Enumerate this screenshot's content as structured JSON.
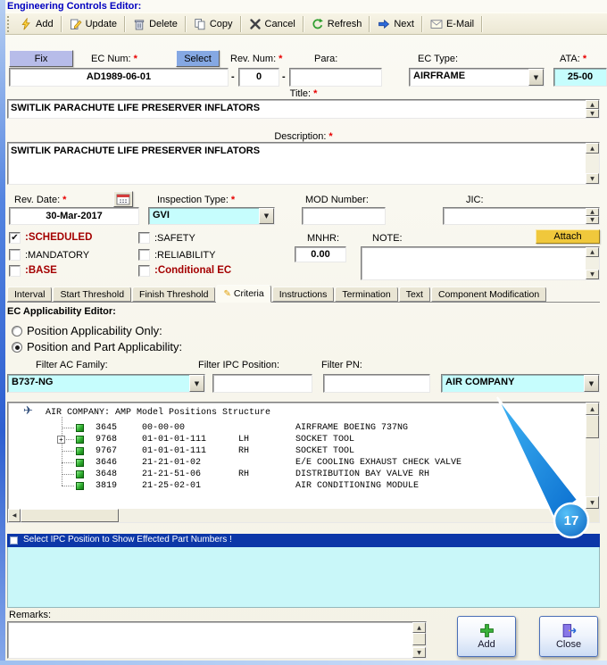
{
  "window": {
    "title": "Engineering Controls Editor:"
  },
  "toolbar": {
    "buttons": [
      "Add",
      "Update",
      "Delete",
      "Copy",
      "Cancel",
      "Refresh",
      "Next",
      "E-Mail"
    ]
  },
  "header": {
    "fix_button": "Fix",
    "ec_num_label": "EC Num:",
    "select_button": "Select",
    "ec_num_value": "AD1989-06-01",
    "dash": "-",
    "rev_num_label": "Rev. Num:",
    "rev_num_value": "0",
    "para_label": "Para:",
    "para_value": "",
    "ec_type_label": "EC Type:",
    "ec_type_value": "AIRFRAME",
    "ata_label": "ATA:",
    "ata_value": "25-00",
    "required_mark": "*"
  },
  "title_section": {
    "label": "Title:",
    "value": "SWITLIK PARACHUTE LIFE PRESERVER INFLATORS"
  },
  "description_section": {
    "label": "Description:",
    "value": "SWITLIK PARACHUTE LIFE PRESERVER INFLATORS"
  },
  "details": {
    "rev_date_label": "Rev. Date:",
    "rev_date_value": "30-Mar-2017",
    "inspection_type_label": "Inspection Type:",
    "inspection_type_value": "GVI",
    "mod_number_label": "MOD Number:",
    "mod_number_value": "",
    "jic_label": "JIC:",
    "jic_value": ""
  },
  "flags": {
    "scheduled_label": ":SCHEDULED",
    "scheduled_checked": true,
    "safety_label": ":SAFETY",
    "safety_checked": false,
    "mandatory_label": ":MANDATORY",
    "mandatory_checked": false,
    "reliability_label": ":RELIABILITY",
    "reliability_checked": false,
    "base_label": ":BASE",
    "base_checked": false,
    "conditional_label": ":Conditional EC",
    "conditional_checked": false,
    "mnhr_label": "MNHR:",
    "mnhr_value": "0.00",
    "note_label": "NOTE:",
    "note_value": "",
    "attach_button": "Attach"
  },
  "tabs": {
    "labels": [
      "Interval",
      "Start Threshold",
      "Finish Threshold",
      "Criteria",
      "Instructions",
      "Termination",
      "Text",
      "Component Modification"
    ],
    "selected_label": "Criteria",
    "selected_index": 3
  },
  "applicability": {
    "section_title": "EC Applicability Editor:",
    "position_only_label": "Position Applicability Only:",
    "position_only_selected": false,
    "position_part_label": "Position and Part Applicability:",
    "position_part_selected": true,
    "filter_ac_family_label": "Filter AC Family:",
    "filter_ac_family_value": "B737-NG",
    "filter_ipc_position_label": "Filter IPC Position:",
    "filter_ipc_position_value": "",
    "filter_pn_label": "Filter PN:",
    "filter_pn_value": "",
    "company_value": "AIR COMPANY"
  },
  "tree": {
    "root_label": "AIR COMPANY: AMP Model Positions Structure",
    "rows": [
      {
        "id": "3645",
        "position": "00-00-00",
        "side": "",
        "description": "AIRFRAME BOEING 737NG",
        "expandable": false
      },
      {
        "id": "9768",
        "position": "01-01-01-111",
        "side": "LH",
        "description": "SOCKET TOOL",
        "expandable": true
      },
      {
        "id": "9767",
        "position": "01-01-01-111",
        "side": "RH",
        "description": "SOCKET TOOL",
        "expandable": false
      },
      {
        "id": "3646",
        "position": "21-21-01-02",
        "side": "",
        "description": "E/E COOLING EXHAUST CHECK VALVE",
        "expandable": false
      },
      {
        "id": "3648",
        "position": "21-21-51-06",
        "side": "RH",
        "description": "DISTRIBUTION BAY VALVE RH",
        "expandable": false
      },
      {
        "id": "3819",
        "position": "21-25-02-01",
        "side": "",
        "description": "AIR CONDITIONING MODULE",
        "expandable": false
      }
    ]
  },
  "ipc_bar": {
    "label": "Select IPC Position to Show Effected Part Numbers !"
  },
  "remarks": {
    "label": "Remarks:",
    "value": ""
  },
  "footer": {
    "add_label": "Add",
    "close_label": "Close"
  },
  "callout": {
    "number": "17"
  },
  "icons": {
    "scroll_up": "▲",
    "scroll_down": "▼",
    "scroll_left": "◀",
    "scroll_right": "▶",
    "dropdown_arrow": "▼",
    "check": "✔",
    "criteria_tab": "✎",
    "plane": "✈",
    "expand_plus": "+"
  },
  "colors": {
    "cyan_field": "#c6fdfd",
    "info_bar_blue": "#0c37a8",
    "callout_blue": "#1191e8",
    "required_red": "#e80000",
    "flag_red": "#a40000"
  }
}
